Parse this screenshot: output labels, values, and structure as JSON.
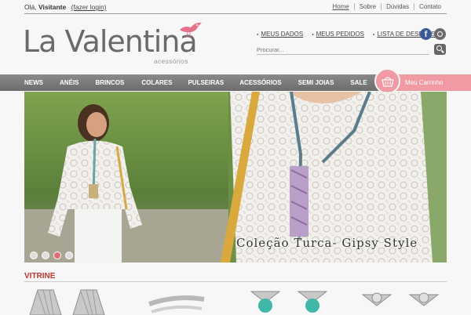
{
  "topbar": {
    "greeting": "Olá,",
    "visitor": "Visitante",
    "login_link": "(fazer login)",
    "links": [
      "Home",
      "Sobre",
      "Dúvidas",
      "Contato"
    ]
  },
  "header": {
    "logo_text": "La Valentina",
    "logo_sub": "acessórios",
    "account_links": [
      "MEUS DADOS",
      "MEUS PEDIDOS",
      "LISTA DE DESEJOS"
    ],
    "social_icons": [
      "facebook-icon",
      "instagram-icon"
    ],
    "search_placeholder": "Procurar..."
  },
  "nav": {
    "items": [
      "NEWS",
      "ANÉIS",
      "BRINCOS",
      "COLARES",
      "PULSEIRAS",
      "ACESSÓRIOS",
      "SEMI JOIAS",
      "SALE"
    ],
    "cart_label": "Meu Carrinho"
  },
  "banner": {
    "caption": "Coleção Turca- Gipsy Style",
    "slides": 4,
    "active_slide": 3
  },
  "vitrine": {
    "title": "VITRINE"
  },
  "colors": {
    "accent_pink": "#f19aa3",
    "nav_gray": "#7a7a7a",
    "section_red": "#c0342c"
  }
}
